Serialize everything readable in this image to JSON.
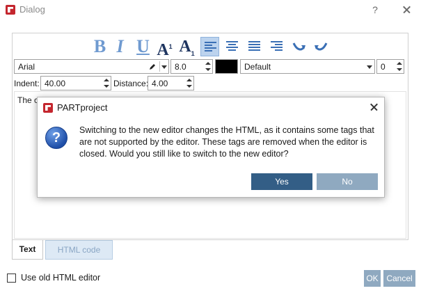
{
  "window": {
    "title": "Dialog",
    "help": "?"
  },
  "toolbar": {
    "bold": "B",
    "italic": "I",
    "underline": "U",
    "superscript_base": "A",
    "superscript_mark": "1",
    "subscript_base": "A",
    "subscript_mark": "1",
    "buttons": [
      "bold-icon",
      "italic-icon",
      "underline-icon",
      "superscript-icon",
      "subscript-icon",
      "align-left-icon",
      "align-center-icon",
      "align-justify-icon",
      "align-right-icon",
      "undo-icon",
      "redo-icon"
    ],
    "active": "align-left-icon"
  },
  "format": {
    "font": "Arial",
    "size": "8.0",
    "color": "#000000",
    "style": "Default",
    "spacing": "0"
  },
  "indent": {
    "label": "Indent:",
    "value": "40.00"
  },
  "distance": {
    "label": "Distance:",
    "value": "4.00"
  },
  "editor": {
    "text": "The c"
  },
  "modal": {
    "title": "PARTproject",
    "message": "Switching to the new editor changes the HTML, as it contains some tags that are not supported by the editor. These tags are removed when the editor is closed. Would you still like to switch to the new editor?",
    "question_mark": "?",
    "yes": "Yes",
    "no": "No"
  },
  "tabs": {
    "text": "Text",
    "html": "HTML code",
    "active": "Text"
  },
  "footer": {
    "use_old_label": "Use old HTML editor",
    "use_old_checked": false,
    "ok": "OK",
    "cancel": "Cancel"
  },
  "colors": {
    "primary_button": "#335e86",
    "disabled_button": "#8fa9c0",
    "brand": "#c4262e"
  }
}
